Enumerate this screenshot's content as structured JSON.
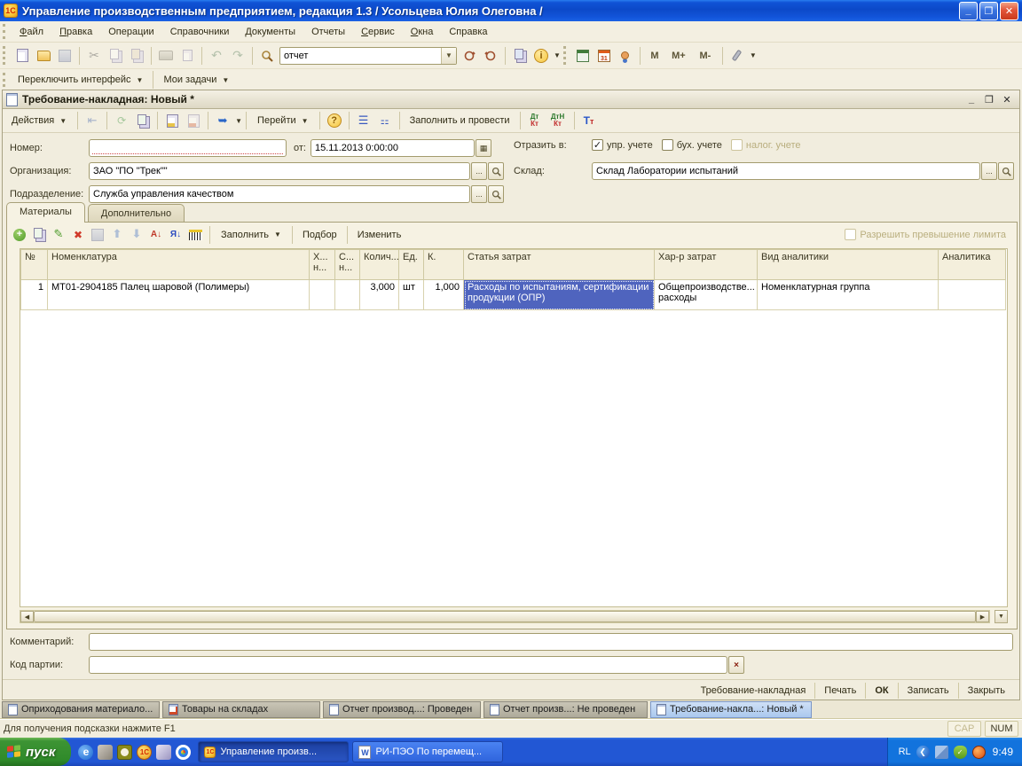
{
  "app": {
    "title": "Управление производственным предприятием, редакция 1.3 / Усольцева Юлия Олеговна /",
    "accent_blue": "#0c49c8",
    "cream_bg": "#f1eddd"
  },
  "menu": {
    "items": [
      "Файл",
      "Правка",
      "Операции",
      "Справочники",
      "Документы",
      "Отчеты",
      "Сервис",
      "Окна",
      "Справка"
    ]
  },
  "toolbar": {
    "search_value": "отчет",
    "memory_buttons": [
      "M",
      "M+",
      "M-"
    ],
    "calendar_glyph": "31"
  },
  "toolbar2": {
    "switch_interface": "Переключить интерфейс",
    "my_tasks": "Мои задачи"
  },
  "doc": {
    "title": "Требование-накладная: Новый *",
    "toolbar": {
      "actions": "Действия",
      "goto": "Перейти",
      "help": "?",
      "fill_and_post": "Заполнить и провести",
      "dtkt1_top": "Дт",
      "dtkt1_bottom": "Кт",
      "dtkt2_top": "ДтН",
      "dtkt2_bottom": "Кт"
    },
    "fields": {
      "number_label": "Номер:",
      "number_value": "",
      "date_label": "от:",
      "date_value": "15.11.2013  0:00:00",
      "org_label": "Организация:",
      "org_value": "ЗАО \"ПО \"Трек\"\"",
      "dept_label": "Подразделение:",
      "dept_value": "Служба управления качеством",
      "reflect_label": "Отразить в:",
      "chk1_label": "упр. учете",
      "chk1_mark": "✓",
      "chk2_label": "бух. учете",
      "chk3_label": "налог. учете",
      "warehouse_label": "Склад:",
      "warehouse_value": "Склад Лаборатории испытаний"
    },
    "tabs": {
      "materials": "Материалы",
      "additional": "Дополнительно"
    },
    "table_toolbar": {
      "fill": "Заполнить",
      "pick": "Подбор",
      "edit": "Изменить",
      "limit_checkbox": "Разрешить превышение лимита",
      "sort_az": "А↓",
      "sort_za": "Я↓"
    },
    "table": {
      "headers": [
        "№",
        "Номенклатура",
        "Х...\nн...",
        "С...\nн...",
        "Колич...",
        "Ед.",
        "К.",
        "Статья затрат",
        "Хар-р затрат",
        "Вид аналитики",
        "Аналитика"
      ],
      "rows": [
        [
          "1",
          "МТ01-2904185 Палец шаровой (Полимеры)",
          "",
          "",
          "3,000",
          "шт",
          "1,000",
          "Расходы по испытаниям, сертификации продукции (ОПР)",
          "Общепроизводстве... расходы",
          "Номенклатурная группа",
          ""
        ]
      ],
      "selected_cell": "Статья затрат, row 1"
    },
    "footer": {
      "comment_label": "Комментарий:",
      "comment_value": "",
      "batch_label": "Код партии:",
      "batch_value": "",
      "clear_glyph": "×"
    },
    "buttons": [
      "Требование-накладная",
      "Печать",
      "ОК",
      "Записать",
      "Закрыть"
    ]
  },
  "mdi_tabs": [
    {
      "label": "Оприходования материало..."
    },
    {
      "label": "Товары на складах"
    },
    {
      "label": "Отчет производ...: Проведен"
    },
    {
      "label": "Отчет произв...: Не проведен"
    },
    {
      "label": "Требование-накла...: Новый *"
    }
  ],
  "status": {
    "hint": "Для получения подсказки нажмите F1",
    "cap": "CAP",
    "num": "NUM"
  },
  "taskbar": {
    "start": "пуск",
    "tasks": [
      {
        "label": "Управление произв..."
      },
      {
        "label": "РИ-ПЭО По перемещ..."
      }
    ],
    "tray": {
      "lang": "RL",
      "time": "9:49"
    }
  }
}
